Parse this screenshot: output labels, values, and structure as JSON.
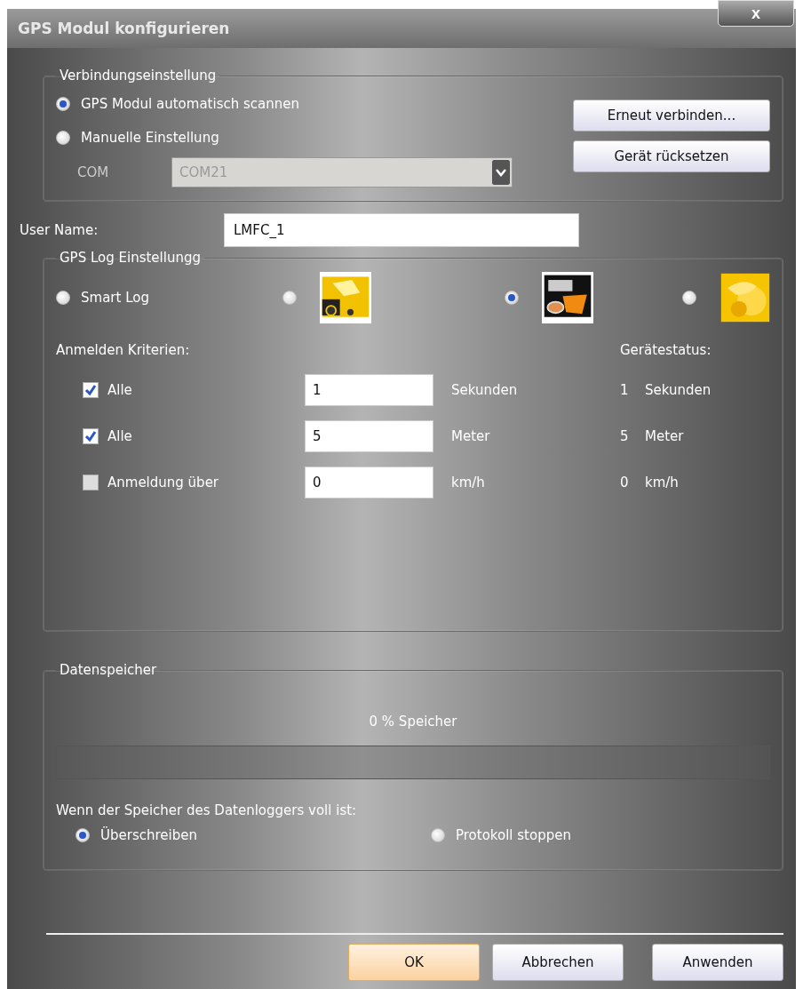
{
  "window": {
    "title": "GPS Modul konfigurieren",
    "close": "x"
  },
  "connection": {
    "title": "Verbindungseinstellung",
    "modes": [
      {
        "label": "GPS Modul automatisch scannen",
        "selected": true
      },
      {
        "label": "Manuelle Einstellung",
        "selected": false
      }
    ],
    "com": {
      "label": "COM",
      "value": "COM21",
      "disabled": true
    },
    "buttons": [
      "Erneut verbinden...",
      "Gerät rücksetzen"
    ]
  },
  "user_name": {
    "label": "User Name:",
    "value": "LMFC_1"
  },
  "log": {
    "title": "GPS Log Einstellungg",
    "modes": [
      {
        "kind": "text",
        "label": "Smart Log",
        "selected": false
      },
      {
        "kind": "truck",
        "selected": false
      },
      {
        "kind": "machine",
        "selected": true
      },
      {
        "kind": "flower",
        "selected": false
      }
    ],
    "criteria_title": "Anmelden Kriterien:",
    "status_title": "Gerätestatus:",
    "criteria": [
      {
        "label": "Alle",
        "checked": true,
        "value": "1",
        "unit": "Sekunden",
        "status_value": "1",
        "status_unit": "Sekunden"
      },
      {
        "label": "Alle",
        "checked": true,
        "value": "5",
        "unit": "Meter",
        "status_value": "5",
        "status_unit": "Meter"
      },
      {
        "label": "Anmeldung über",
        "checked": false,
        "value": "0",
        "unit": "km/h",
        "status_value": "0",
        "status_unit": "km/h"
      }
    ]
  },
  "storage": {
    "title": "Datenspeicher",
    "reading": "0 % Speicher",
    "level": 0,
    "full_label": "Wenn der Speicher des Datenloggers voll ist:",
    "options": [
      {
        "label": "Überschreiben",
        "selected": true
      },
      {
        "label": "Protokoll stoppen",
        "selected": false
      }
    ]
  },
  "buttons": [
    {
      "label": "OK",
      "default": true
    },
    {
      "label": "Abbrechen",
      "default": false
    },
    {
      "label": "Anwenden",
      "default": false
    }
  ]
}
